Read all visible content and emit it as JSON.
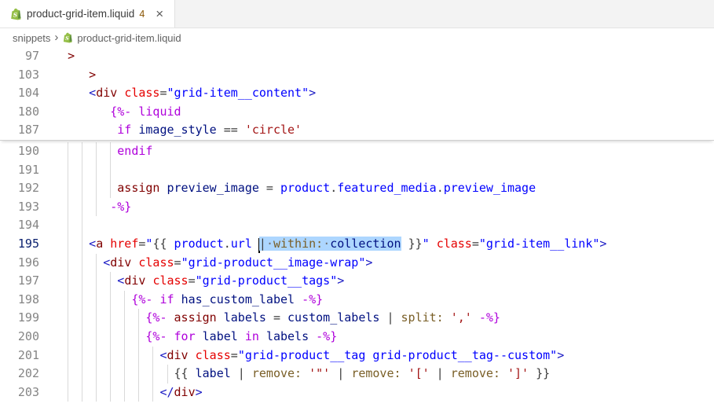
{
  "tab": {
    "file": "product-grid-item.liquid",
    "problems_badge": "4",
    "close_glyph": "×"
  },
  "breadcrumb": {
    "folder": "snippets",
    "separator": "›",
    "file": "product-grid-item.liquid"
  },
  "colors": {
    "selection": "#ADD6FF",
    "badge": "#895503",
    "shopify_green": "#95BF47",
    "shopify_green_dark": "#5E8E3E",
    "syntax": {
      "plain": "#3B3B3B",
      "kw": "#AF00DB",
      "kwred": "#800000",
      "tag": "#800000",
      "angle": "#1A1AC4",
      "attr": "#E50000",
      "attrval": "#0000FF",
      "obj": "#0000FF",
      "dot": "#3B3B3B",
      "var": "#001080",
      "fn": "#795E26",
      "str": "#A31515",
      "punct": "#3B3B3B",
      "wsdot": "#6E6E6E"
    }
  },
  "editor": {
    "sticky": [
      {
        "n": 97,
        "ind": 2,
        "g": [],
        "toks": [
          [
            "tag",
            ">"
          ]
        ]
      },
      {
        "n": 103,
        "ind": 5,
        "g": [],
        "toks": [
          [
            "tag",
            ">"
          ]
        ]
      },
      {
        "n": 104,
        "ind": 5,
        "g": [],
        "toks": [
          [
            "angle",
            "<"
          ],
          [
            "tag",
            "div"
          ],
          [
            "plain",
            " "
          ],
          [
            "attr",
            "class"
          ],
          [
            "punct",
            "="
          ],
          [
            "attrval",
            "\"grid-item__content\""
          ],
          [
            "angle",
            ">"
          ]
        ]
      },
      {
        "n": 180,
        "ind": 8,
        "g": [],
        "toks": [
          [
            "kw",
            "{%-"
          ],
          [
            "plain",
            " "
          ],
          [
            "kw",
            "liquid"
          ]
        ]
      },
      {
        "n": 187,
        "ind": 9,
        "g": [],
        "toks": [
          [
            "kw",
            "if"
          ],
          [
            "plain",
            " "
          ],
          [
            "var",
            "image_style"
          ],
          [
            "punct",
            " == "
          ],
          [
            "str",
            "'circle'"
          ]
        ]
      }
    ],
    "content": [
      {
        "n": 190,
        "ind": 9,
        "g": [
          2,
          4,
          6,
          8
        ],
        "toks": [
          [
            "kw",
            "endif"
          ]
        ]
      },
      {
        "n": 191,
        "ind": 0,
        "g": [
          2,
          4,
          6,
          8
        ],
        "toks": []
      },
      {
        "n": 192,
        "ind": 9,
        "g": [
          2,
          4,
          6,
          8
        ],
        "toks": [
          [
            "kwred",
            "assign"
          ],
          [
            "plain",
            " "
          ],
          [
            "var",
            "preview_image"
          ],
          [
            "punct",
            " = "
          ],
          [
            "obj",
            "product"
          ],
          [
            "dot",
            "."
          ],
          [
            "obj",
            "featured_media"
          ],
          [
            "dot",
            "."
          ],
          [
            "obj",
            "preview_image"
          ]
        ]
      },
      {
        "n": 193,
        "ind": 8,
        "g": [
          2,
          4,
          6
        ],
        "toks": [
          [
            "kw",
            "-%}"
          ]
        ]
      },
      {
        "n": 194,
        "ind": 0,
        "g": [
          2,
          4
        ],
        "toks": []
      },
      {
        "n": 195,
        "ind": 5,
        "a": 1,
        "g": [
          2,
          4
        ],
        "toks": [
          [
            "angle",
            "<"
          ],
          [
            "tag",
            "a"
          ],
          [
            "plain",
            " "
          ],
          [
            "attr",
            "href"
          ],
          [
            "punct",
            "="
          ],
          [
            "attrval",
            "\""
          ],
          [
            "punct",
            "{{ "
          ],
          [
            "obj",
            "product"
          ],
          [
            "dot",
            "."
          ],
          [
            "obj",
            "url"
          ],
          [
            "plain",
            " "
          ],
          [
            "cursor",
            ""
          ],
          [
            "punct",
            "|",
            1
          ],
          [
            "wsdot",
            "·",
            1
          ],
          [
            "fn",
            "within:",
            1
          ],
          [
            "wsdot",
            "·",
            1
          ],
          [
            "var",
            "collection",
            1
          ],
          [
            "plain",
            " "
          ],
          [
            "punct",
            "}}"
          ],
          [
            "attrval",
            "\""
          ],
          [
            "plain",
            " "
          ],
          [
            "attr",
            "class"
          ],
          [
            "punct",
            "="
          ],
          [
            "attrval",
            "\"grid-item__link\""
          ],
          [
            "angle",
            ">"
          ]
        ]
      },
      {
        "n": 196,
        "ind": 7,
        "g": [
          2,
          4,
          6
        ],
        "toks": [
          [
            "angle",
            "<"
          ],
          [
            "tag",
            "div"
          ],
          [
            "plain",
            " "
          ],
          [
            "attr",
            "class"
          ],
          [
            "punct",
            "="
          ],
          [
            "attrval",
            "\"grid-product__image-wrap\""
          ],
          [
            "angle",
            ">"
          ]
        ]
      },
      {
        "n": 197,
        "ind": 9,
        "g": [
          2,
          4,
          6,
          8
        ],
        "toks": [
          [
            "angle",
            "<"
          ],
          [
            "tag",
            "div"
          ],
          [
            "plain",
            " "
          ],
          [
            "attr",
            "class"
          ],
          [
            "punct",
            "="
          ],
          [
            "attrval",
            "\"grid-product__tags\""
          ],
          [
            "angle",
            ">"
          ]
        ]
      },
      {
        "n": 198,
        "ind": 11,
        "g": [
          2,
          4,
          6,
          8,
          10
        ],
        "toks": [
          [
            "kw",
            "{%-"
          ],
          [
            "plain",
            " "
          ],
          [
            "kw",
            "if"
          ],
          [
            "plain",
            " "
          ],
          [
            "var",
            "has_custom_label"
          ],
          [
            "plain",
            " "
          ],
          [
            "kw",
            "-%}"
          ]
        ]
      },
      {
        "n": 199,
        "ind": 13,
        "g": [
          2,
          4,
          6,
          8,
          10,
          12
        ],
        "toks": [
          [
            "kw",
            "{%-"
          ],
          [
            "plain",
            " "
          ],
          [
            "kwred",
            "assign"
          ],
          [
            "plain",
            " "
          ],
          [
            "var",
            "labels"
          ],
          [
            "punct",
            " = "
          ],
          [
            "var",
            "custom_labels"
          ],
          [
            "punct",
            " | "
          ],
          [
            "fn",
            "split:"
          ],
          [
            "plain",
            " "
          ],
          [
            "str",
            "','"
          ],
          [
            "plain",
            " "
          ],
          [
            "kw",
            "-%}"
          ]
        ]
      },
      {
        "n": 200,
        "ind": 13,
        "g": [
          2,
          4,
          6,
          8,
          10,
          12
        ],
        "toks": [
          [
            "kw",
            "{%-"
          ],
          [
            "plain",
            " "
          ],
          [
            "kw",
            "for"
          ],
          [
            "plain",
            " "
          ],
          [
            "var",
            "label"
          ],
          [
            "plain",
            " "
          ],
          [
            "kw",
            "in"
          ],
          [
            "plain",
            " "
          ],
          [
            "var",
            "labels"
          ],
          [
            "plain",
            " "
          ],
          [
            "kw",
            "-%}"
          ]
        ]
      },
      {
        "n": 201,
        "ind": 15,
        "g": [
          2,
          4,
          6,
          8,
          10,
          12,
          14
        ],
        "toks": [
          [
            "angle",
            "<"
          ],
          [
            "tag",
            "div"
          ],
          [
            "plain",
            " "
          ],
          [
            "attr",
            "class"
          ],
          [
            "punct",
            "="
          ],
          [
            "attrval",
            "\"grid-product__tag grid-product__tag--custom\""
          ],
          [
            "angle",
            ">"
          ]
        ]
      },
      {
        "n": 202,
        "ind": 17,
        "g": [
          2,
          4,
          6,
          8,
          10,
          12,
          14,
          16
        ],
        "toks": [
          [
            "punct",
            "{{ "
          ],
          [
            "var",
            "label"
          ],
          [
            "punct",
            " | "
          ],
          [
            "fn",
            "remove:"
          ],
          [
            "plain",
            " "
          ],
          [
            "str",
            "'\"'"
          ],
          [
            "punct",
            " | "
          ],
          [
            "fn",
            "remove:"
          ],
          [
            "plain",
            " "
          ],
          [
            "str",
            "'['"
          ],
          [
            "punct",
            " | "
          ],
          [
            "fn",
            "remove:"
          ],
          [
            "plain",
            " "
          ],
          [
            "str",
            "']'"
          ],
          [
            "punct",
            " }}"
          ]
        ]
      },
      {
        "n": 203,
        "ind": 15,
        "g": [
          2,
          4,
          6,
          8,
          10,
          12,
          14
        ],
        "toks": [
          [
            "angle",
            "</"
          ],
          [
            "tag",
            "div"
          ],
          [
            "angle",
            ">"
          ]
        ]
      }
    ]
  }
}
